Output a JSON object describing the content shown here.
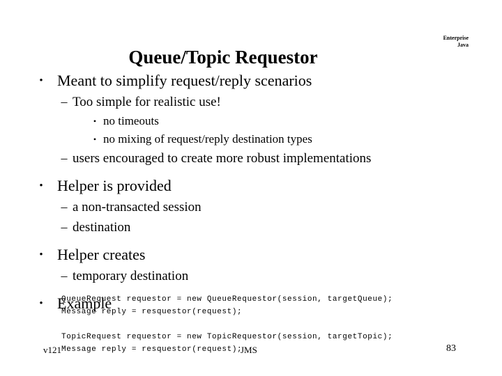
{
  "slide": {
    "title": "Queue/Topic Requestor",
    "page_number": "83",
    "background_color": "#ffffff",
    "text_color": "#000000"
  },
  "brand": {
    "line1": "Enterprise",
    "line2": "Java"
  },
  "markers": {
    "bullet": "•",
    "dash": "–"
  },
  "bullets": [
    {
      "level": 1,
      "text": "Meant to simplify request/reply scenarios"
    },
    {
      "level": 2,
      "text": "Too simple for realistic use!"
    },
    {
      "level": 3,
      "text": "no timeouts"
    },
    {
      "level": 3,
      "text": "no mixing of request/reply destination types"
    },
    {
      "level": 2,
      "text": "users encouraged to create more robust implementations"
    },
    {
      "level": 1,
      "text": "Helper is provided"
    },
    {
      "level": 2,
      "text": "a non-transacted session"
    },
    {
      "level": 2,
      "text": "destination"
    },
    {
      "level": 1,
      "text": "Helper creates"
    },
    {
      "level": 2,
      "text": "temporary destination"
    },
    {
      "level": 1,
      "text": "Example"
    }
  ],
  "code": {
    "lines": [
      "QueueRequest requestor = new QueueRequestor(session, targetQueue);",
      "Message reply = resquestor(request);",
      "",
      "TopicRequest requestor = new TopicRequestor(session, targetTopic);",
      "Message reply = resquestor(request);"
    ]
  },
  "footer": {
    "left": "v121",
    "center": "JMS",
    "right": "83"
  }
}
